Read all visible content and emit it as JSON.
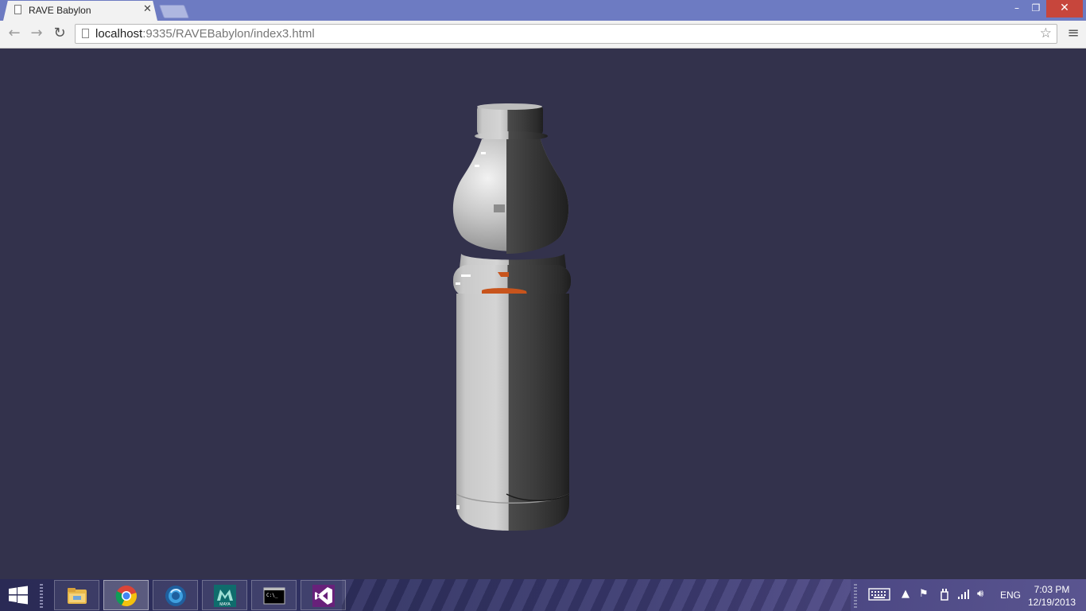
{
  "browser": {
    "tab_title": "RAVE Babylon",
    "tab_close": "✕",
    "url_host": "localhost",
    "url_rest": ":9335/RAVEBabylon/index3.html",
    "window_min": "–",
    "window_max": "❐",
    "window_close": "✕",
    "back": "←",
    "forward": "→",
    "reload": "↻",
    "star": "☆",
    "menu": "≡"
  },
  "scene": {
    "background": "#33324c",
    "object": "bottle-3d-model"
  },
  "taskbar": {
    "apps": [
      {
        "name": "file-explorer",
        "icon": "folder-icon"
      },
      {
        "name": "chrome",
        "icon": "chrome-icon",
        "active": true
      },
      {
        "name": "app-blue-circle",
        "icon": "blue-orb-icon"
      },
      {
        "name": "maya",
        "icon": "maya-icon",
        "label": "MAYA"
      },
      {
        "name": "command-prompt",
        "icon": "terminal-icon",
        "label": "C:\\_"
      },
      {
        "name": "visual-studio",
        "icon": "visual-studio-icon"
      }
    ],
    "tray": {
      "language": "ENG",
      "time": "7:03 PM",
      "date": "12/19/2013"
    }
  },
  "colors": {
    "titlebar": "#6d7bc2",
    "close": "#c7463c",
    "viewport": "#33324c",
    "bottle_label": "#c8541c"
  }
}
